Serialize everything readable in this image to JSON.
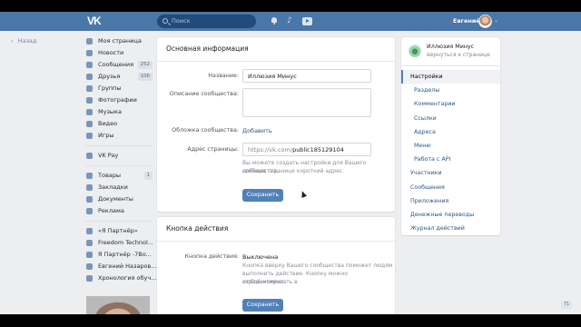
{
  "topbar": {
    "logo": "VK",
    "search_placeholder": "Поиск",
    "user_name": "Евгений"
  },
  "left": {
    "back_label": "Назад",
    "nav": [
      {
        "label": "Моя страница",
        "icon": "home-icon"
      },
      {
        "label": "Новости",
        "icon": "news-icon"
      },
      {
        "label": "Сообщения",
        "icon": "messages-icon",
        "count": "252"
      },
      {
        "label": "Друзья",
        "icon": "friends-icon",
        "count": "106"
      },
      {
        "label": "Группы",
        "icon": "groups-icon"
      },
      {
        "label": "Фотографии",
        "icon": "photos-icon"
      },
      {
        "label": "Музыка",
        "icon": "music-icon"
      },
      {
        "label": "Видео",
        "icon": "video-icon"
      },
      {
        "label": "Игры",
        "icon": "games-icon"
      },
      {
        "label": "VK Pay",
        "icon": "vkpay-icon"
      },
      {
        "label": "Товары",
        "icon": "goods-icon",
        "count": "1"
      },
      {
        "label": "Закладки",
        "icon": "bookmarks-icon"
      },
      {
        "label": "Документы",
        "icon": "documents-icon"
      },
      {
        "label": "Реклама",
        "icon": "ads-icon"
      },
      {
        "label": "«Я Партнёр»",
        "icon": "group-icon"
      },
      {
        "label": "Freedom Technol...",
        "icon": "group-icon"
      },
      {
        "label": "Я Партнёр -7Bo...",
        "icon": "group-icon"
      },
      {
        "label": "Евгений Назаров...",
        "icon": "group-icon"
      },
      {
        "label": "Хронология обуч...",
        "icon": "group-icon"
      }
    ]
  },
  "basic": {
    "title": "Основная информация",
    "name_label": "Название:",
    "name_value": "Иллюзия Минус",
    "desc_label": "Описание сообщества:",
    "cover_label": "Обложка сообщества:",
    "cover_link": "Добавить",
    "address_label": "Адрес страницы:",
    "address_prefix": "https://vk.com/",
    "address_value": "public185129104",
    "address_hint_1": "Вы можете создать настройки для Вашего сообщества,",
    "address_hint_2": "добавив странице короткий адрес.",
    "save": "Сохранить"
  },
  "action": {
    "title": "Кнопка действия",
    "label": "Кнопка действия:",
    "value": "Выключена",
    "hint_1": "Кнопка вверху Вашего сообщества поможет людям",
    "hint_2": "выполнить действие. Кнопку можно отредактировать в",
    "hint_3": "любой момент.",
    "save": "Сохранить"
  },
  "right": {
    "group_name": "Иллюзия Минус",
    "group_back": "вернуться к странице",
    "menu": [
      {
        "label": "Настройки",
        "type": "active"
      },
      {
        "label": "Разделы",
        "type": "sub"
      },
      {
        "label": "Комментарии",
        "type": "sub"
      },
      {
        "label": "Ссылки",
        "type": "sub"
      },
      {
        "label": "Адреса",
        "type": "sub"
      },
      {
        "label": "Меню",
        "type": "sub"
      },
      {
        "label": "Работа с API",
        "type": "sub"
      },
      {
        "label": "Участники",
        "type": "main"
      },
      {
        "label": "Сообщения",
        "type": "main"
      },
      {
        "label": "Приложения",
        "type": "main"
      },
      {
        "label": "Денежные переводы",
        "type": "main"
      },
      {
        "label": "Журнал действий",
        "type": "main"
      }
    ]
  },
  "corner_badge": "71"
}
